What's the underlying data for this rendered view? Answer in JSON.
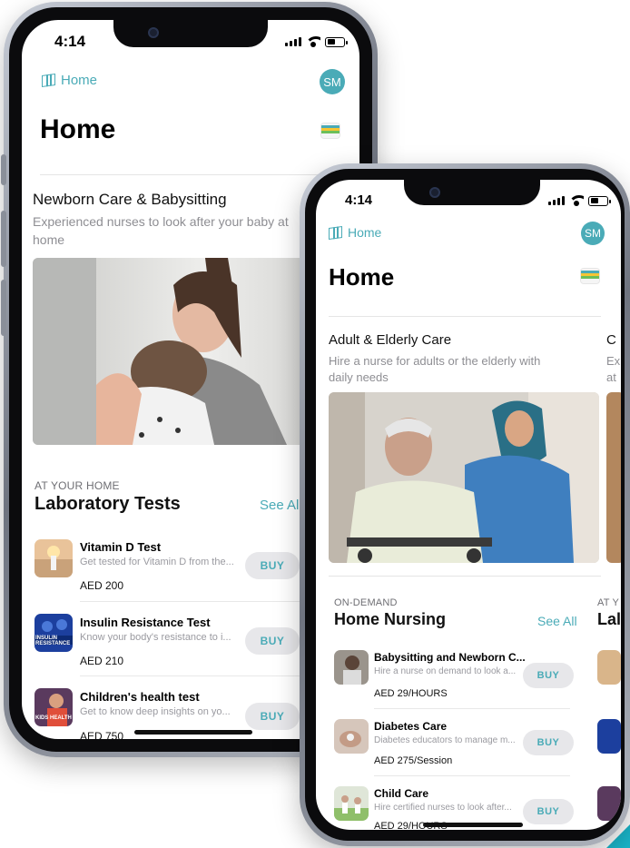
{
  "back_phone": {
    "status_time": "4:14",
    "nav_home": "Home",
    "avatar_initials": "SM",
    "page_title": "Home",
    "featured_card": {
      "title": "Newborn Care & Babysitting",
      "subtitle": "Experienced nurses to look after your baby at home"
    },
    "section": {
      "eyebrow": "AT YOUR HOME",
      "heading": "Laboratory Tests",
      "see_all": "See All"
    },
    "items": [
      {
        "name": "Vitamin D Test",
        "desc": "Get tested for Vitamin D from the...",
        "price": "AED 200",
        "buy": "BUY"
      },
      {
        "name": "Insulin Resistance Test",
        "desc": "Know your body's resistance to i...",
        "price": "AED 210",
        "buy": "BUY",
        "thumb_text": "INSULIN RESISTANCE"
      },
      {
        "name": "Children's health test",
        "desc": "Get to know deep insights on yo...",
        "price": "AED 750",
        "buy": "BUY",
        "thumb_text": "KIDS HEALTH"
      }
    ]
  },
  "front_phone": {
    "status_time": "4:14",
    "nav_home": "Home",
    "avatar_initials": "SM",
    "page_title": "Home",
    "featured_card": {
      "title": "Adult & Elderly Care",
      "subtitle": "Hire a nurse for adults or the elderly with daily needs"
    },
    "peek_card": {
      "title": "C",
      "subtitle": "Ex at"
    },
    "section": {
      "eyebrow": "ON-DEMAND",
      "heading": "Home Nursing",
      "see_all": "See All"
    },
    "peek_section": {
      "eyebrow": "AT Y",
      "heading": "Lal"
    },
    "items": [
      {
        "name": "Babysitting and Newborn C...",
        "desc": "Hire a nurse on demand to look a...",
        "price": "AED 29/HOURS",
        "buy": "BUY"
      },
      {
        "name": "Diabetes Care",
        "desc": "Diabetes educators to manage m...",
        "price": "AED 275/Session",
        "buy": "BUY"
      },
      {
        "name": "Child Care",
        "desc": "Hire certified nurses to look after...",
        "price": "AED 29/HOURS",
        "buy": "BUY"
      }
    ]
  },
  "colors": {
    "accent": "#4aabb7",
    "corner_accent": "#19b4c8",
    "buy_bg": "#e7e7ea"
  },
  "icons": [
    "map-icon",
    "wallet-icon",
    "signal-icon",
    "wifi-icon",
    "battery-icon"
  ]
}
